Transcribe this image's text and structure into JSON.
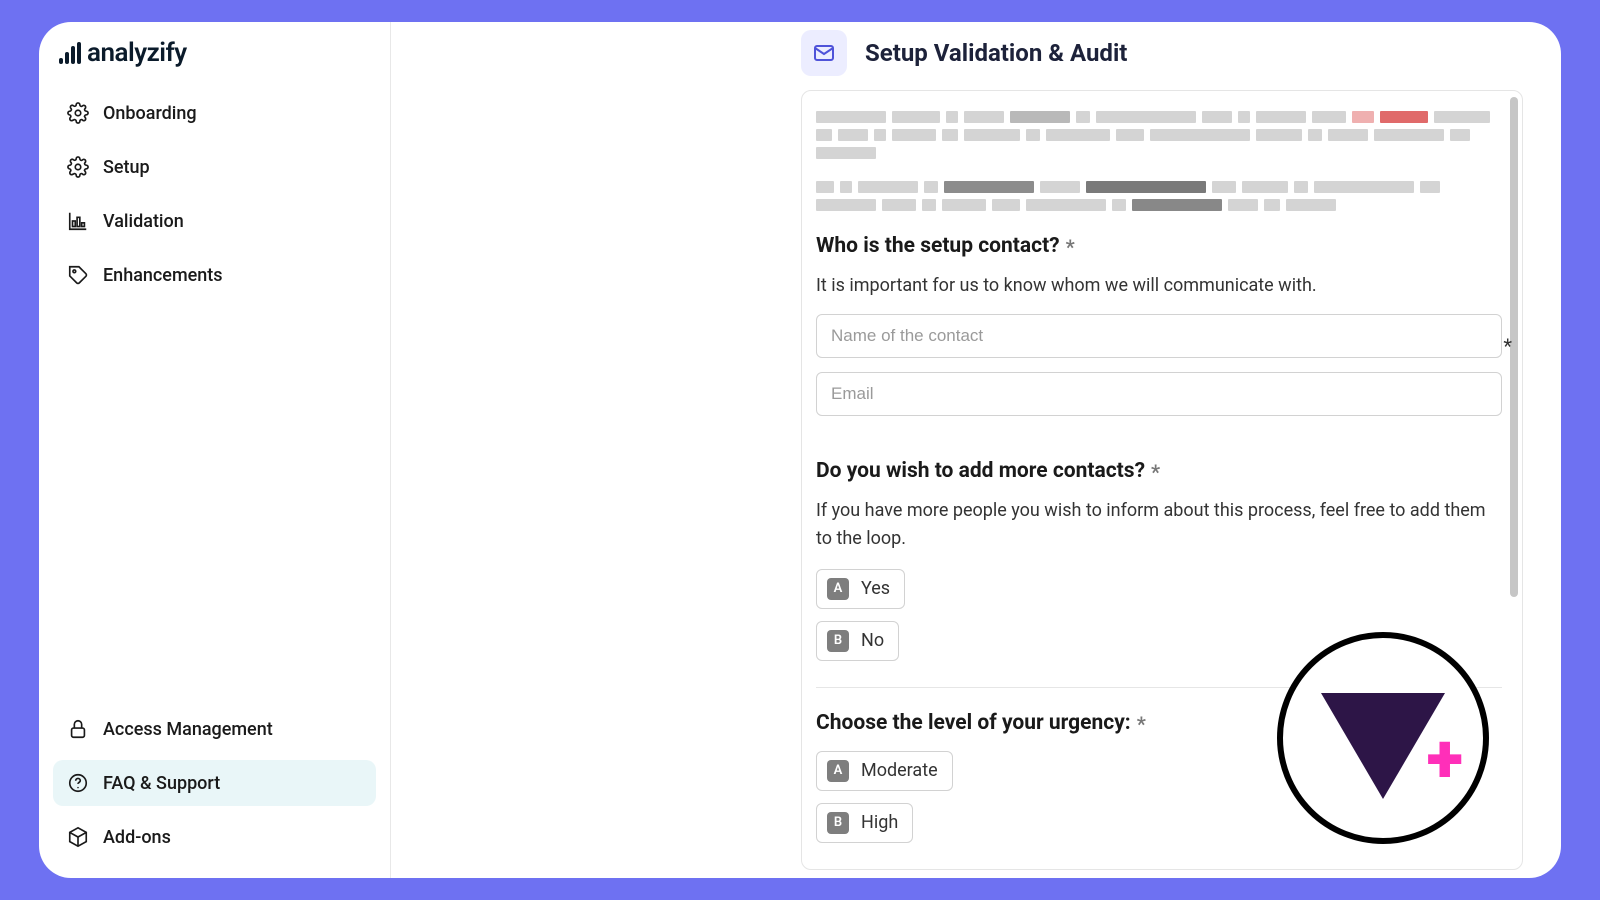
{
  "app": {
    "name": "analyzify"
  },
  "sidebar": {
    "top": [
      {
        "label": "Onboarding"
      },
      {
        "label": "Setup"
      },
      {
        "label": "Validation"
      },
      {
        "label": "Enhancements"
      }
    ],
    "bottom": [
      {
        "label": "Access Management"
      },
      {
        "label": "FAQ & Support",
        "active": true
      },
      {
        "label": "Add-ons"
      }
    ]
  },
  "page": {
    "title": "Setup Validation & Audit"
  },
  "form": {
    "q1": {
      "title": "Who is the setup contact?",
      "helper": "It is important for us to know whom we will communicate with.",
      "name_placeholder": "Name of the contact",
      "email_placeholder": "Email"
    },
    "q2": {
      "title": "Do you wish to add more contacts?",
      "helper": "If you have more people you wish to inform about this process, feel free to add them to the loop.",
      "options": [
        {
          "key": "A",
          "label": "Yes"
        },
        {
          "key": "B",
          "label": "No"
        }
      ]
    },
    "q3": {
      "title": "Choose the level of your urgency:",
      "options": [
        {
          "key": "A",
          "label": "Moderate"
        },
        {
          "key": "B",
          "label": "High"
        }
      ]
    }
  }
}
